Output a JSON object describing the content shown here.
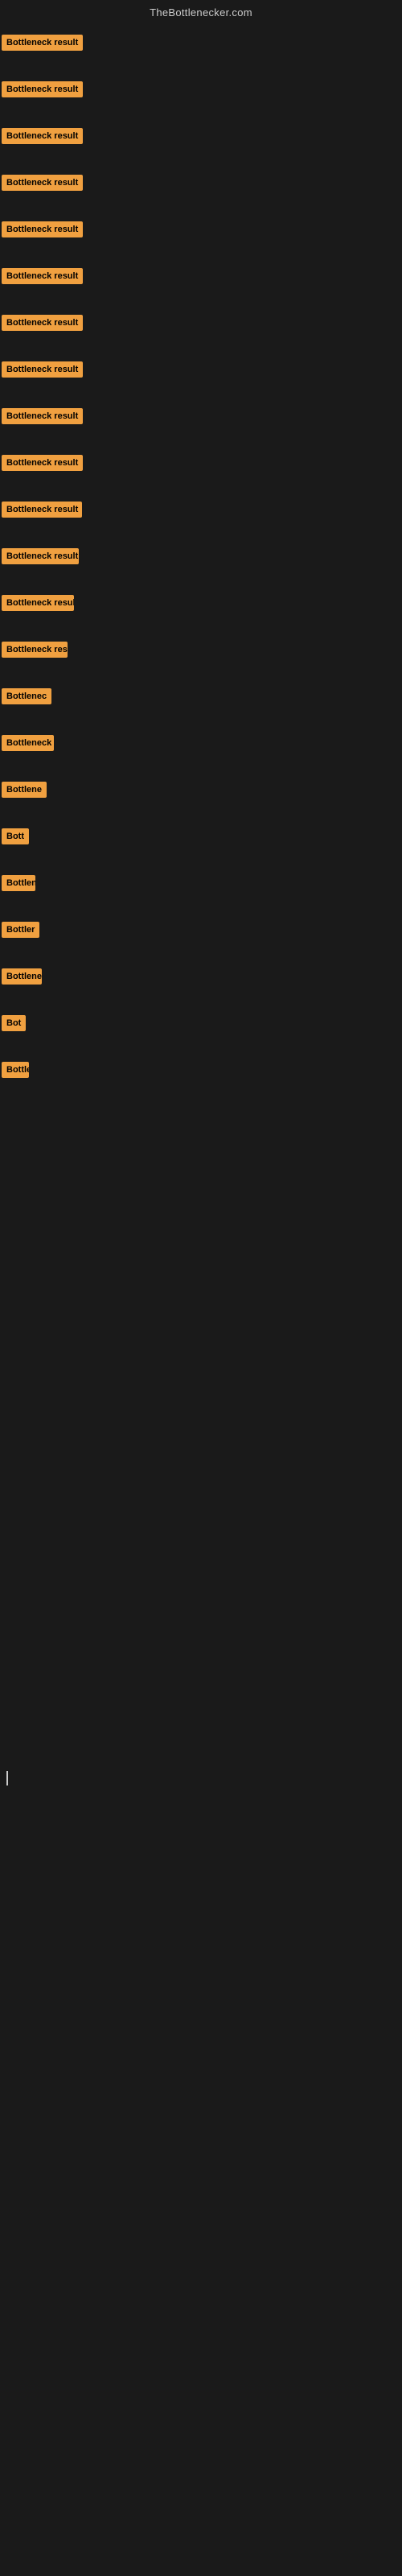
{
  "header": {
    "title": "TheBottlenecker.com"
  },
  "items": [
    {
      "id": 1,
      "label": "Bottleneck result",
      "widthClass": "w-1",
      "rowClass": "row-1"
    },
    {
      "id": 2,
      "label": "Bottleneck result",
      "widthClass": "w-2",
      "rowClass": "row-2"
    },
    {
      "id": 3,
      "label": "Bottleneck result",
      "widthClass": "w-3",
      "rowClass": "row-3"
    },
    {
      "id": 4,
      "label": "Bottleneck result",
      "widthClass": "w-4",
      "rowClass": "row-4"
    },
    {
      "id": 5,
      "label": "Bottleneck result",
      "widthClass": "w-5",
      "rowClass": "row-5"
    },
    {
      "id": 6,
      "label": "Bottleneck result",
      "widthClass": "w-6",
      "rowClass": "row-6"
    },
    {
      "id": 7,
      "label": "Bottleneck result",
      "widthClass": "w-7",
      "rowClass": "row-7"
    },
    {
      "id": 8,
      "label": "Bottleneck result",
      "widthClass": "w-8",
      "rowClass": "row-8"
    },
    {
      "id": 9,
      "label": "Bottleneck result",
      "widthClass": "w-9",
      "rowClass": "row-9"
    },
    {
      "id": 10,
      "label": "Bottleneck result",
      "widthClass": "w-10",
      "rowClass": "row-10"
    },
    {
      "id": 11,
      "label": "Bottleneck result",
      "widthClass": "w-11",
      "rowClass": "row-11"
    },
    {
      "id": 12,
      "label": "Bottleneck result",
      "widthClass": "w-12",
      "rowClass": "row-12"
    },
    {
      "id": 13,
      "label": "Bottleneck result",
      "widthClass": "w-13",
      "rowClass": "row-13"
    },
    {
      "id": 14,
      "label": "Bottleneck res",
      "widthClass": "w-14",
      "rowClass": "row-14"
    },
    {
      "id": 15,
      "label": "Bottlenec",
      "widthClass": "w-15",
      "rowClass": "row-15"
    },
    {
      "id": 16,
      "label": "Bottleneck r",
      "widthClass": "w-16",
      "rowClass": "row-16"
    },
    {
      "id": 17,
      "label": "Bottlene",
      "widthClass": "w-17",
      "rowClass": "row-17"
    },
    {
      "id": 18,
      "label": "Bott",
      "widthClass": "w-18",
      "rowClass": "row-18"
    },
    {
      "id": 19,
      "label": "Bottlene",
      "widthClass": "w-19",
      "rowClass": "row-19"
    },
    {
      "id": 20,
      "label": "Bottler",
      "widthClass": "w-20",
      "rowClass": "row-20"
    },
    {
      "id": 21,
      "label": "Bottleneck",
      "widthClass": "w-21",
      "rowClass": "row-21"
    },
    {
      "id": 22,
      "label": "Bot",
      "widthClass": "w-22",
      "rowClass": "row-22"
    },
    {
      "id": 23,
      "label": "Bottlene",
      "widthClass": "w-23",
      "rowClass": "row-23"
    }
  ],
  "colors": {
    "badge_bg": "#f0a040",
    "badge_text": "#000000",
    "background": "#1a1a1a",
    "header_text": "#cccccc"
  }
}
